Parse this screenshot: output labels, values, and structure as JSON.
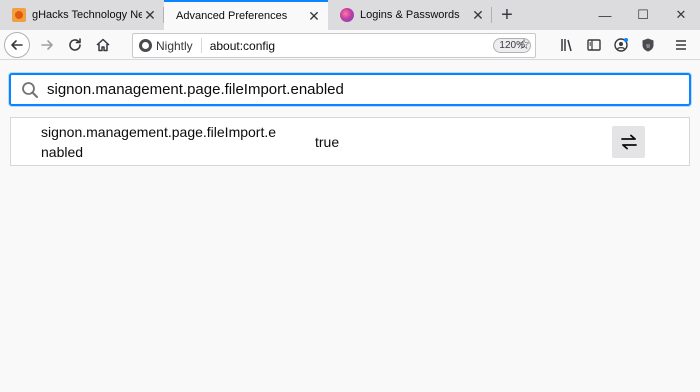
{
  "tabs": [
    {
      "title": "gHacks Technology News",
      "favicon": "ghacks-favicon",
      "active": false
    },
    {
      "title": "Advanced Preferences",
      "favicon": "",
      "active": true
    },
    {
      "title": "Logins & Passwords",
      "favicon": "logins-favicon",
      "active": false
    }
  ],
  "urlbar": {
    "identity_label": "Nightly",
    "url": "about:config",
    "zoom": "120%"
  },
  "search": {
    "value": "signon.management.page.fileImport.enabled"
  },
  "pref": {
    "name": "signon.management.page.fileImport.enabled",
    "value": "true"
  },
  "colors": {
    "accent": "#0a84ff",
    "tabstrip": "#dcdcdf",
    "page_bg": "#f9f9fa"
  }
}
